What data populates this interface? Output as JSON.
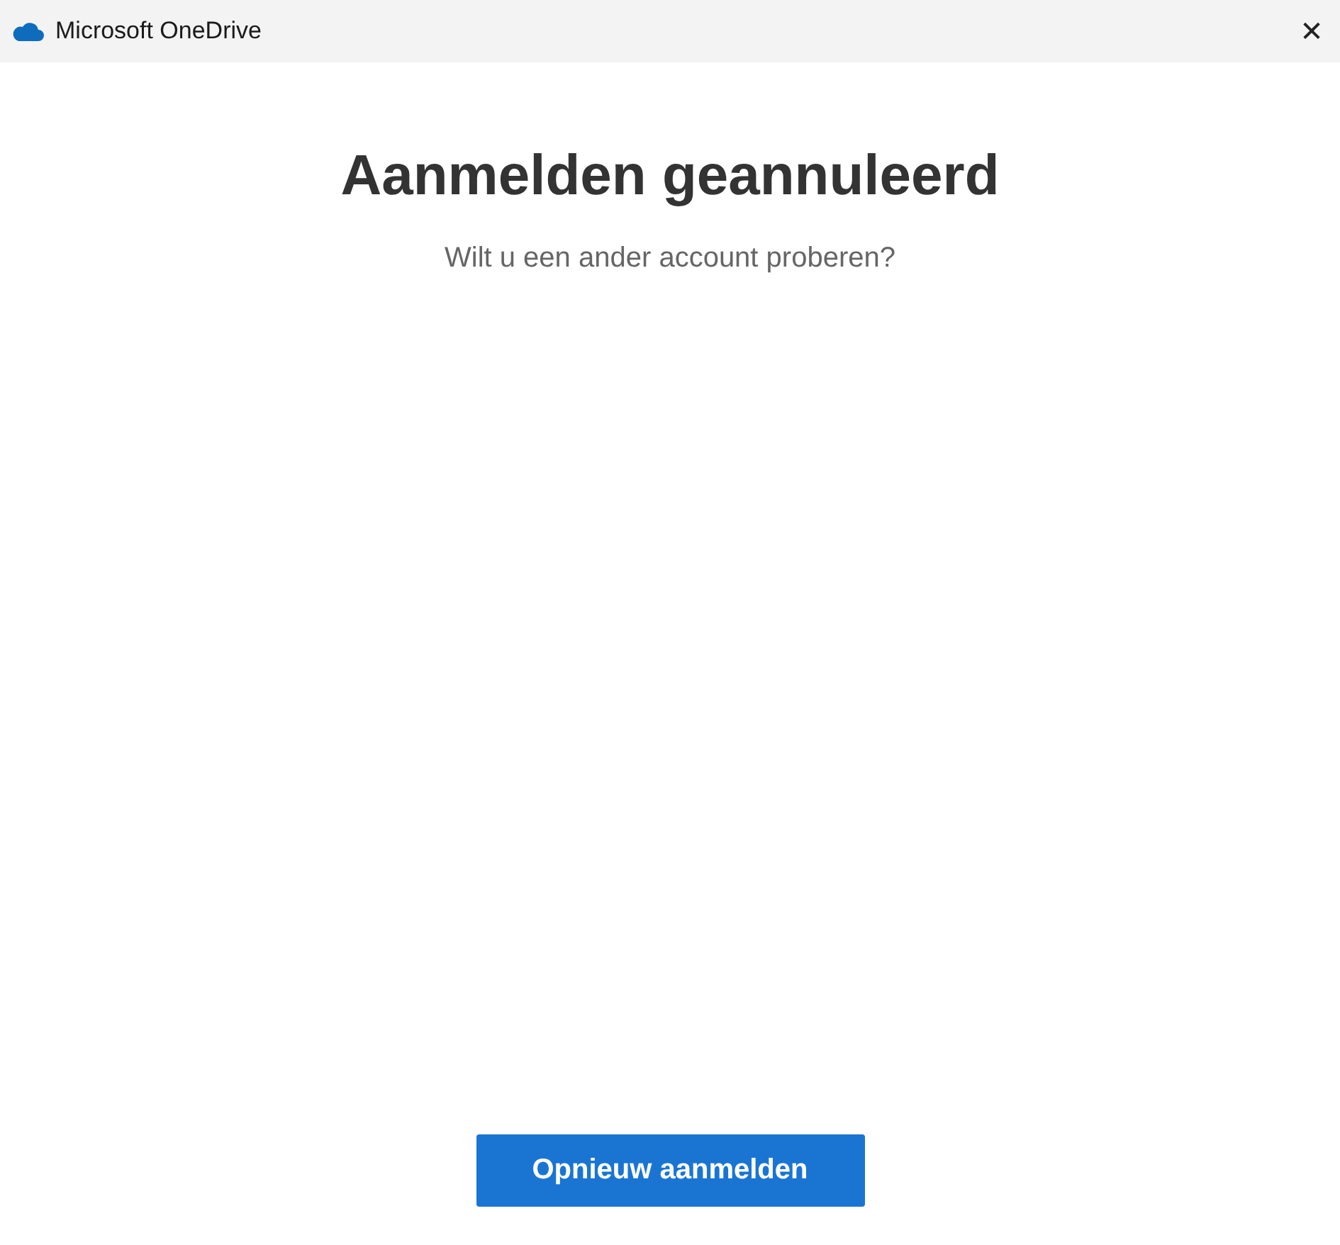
{
  "window": {
    "title": "Microsoft OneDrive",
    "close": "✕"
  },
  "dialog": {
    "heading": "Aanmelden geannuleerd",
    "subtitle": "Wilt u een ander account proberen?"
  },
  "buttons": [
    "Opnieuw aanmelden"
  ]
}
